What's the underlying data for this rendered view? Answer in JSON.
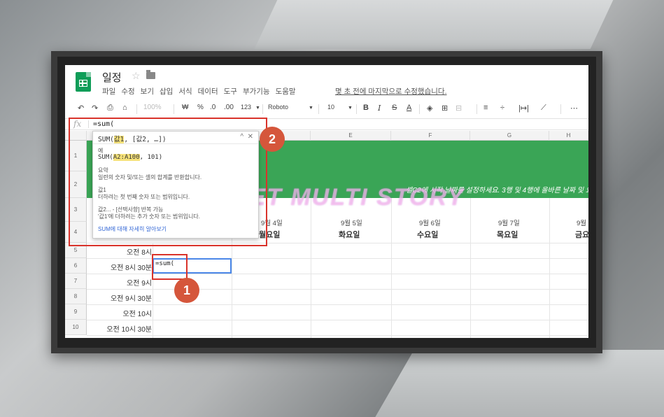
{
  "doc": {
    "title": "일정",
    "menu": [
      "파일",
      "수정",
      "보기",
      "삽입",
      "서식",
      "데이터",
      "도구",
      "부가기능",
      "도움말"
    ],
    "last_edit": "몇 초 전에 마지막으로 수정했습니다."
  },
  "toolbar": {
    "zoom": "100%",
    "currency": "₩",
    "percent": "%",
    "decimal_less": ".0",
    "decimal_more": ".00",
    "format": "123",
    "font": "Roboto",
    "font_size": "10",
    "bold": "B",
    "italic": "I",
    "strike": "S",
    "text_color": "A"
  },
  "formula_bar": {
    "fx": "fx",
    "value": "=sum("
  },
  "columns": [
    "E",
    "F",
    "G",
    "H"
  ],
  "rows": [
    "1",
    "2",
    "3",
    "4",
    "5",
    "6",
    "7",
    "8",
    "9",
    "10"
  ],
  "banner_text": "셀C2에 시작 날짜를 설정하세요. 3행 및 4행에 올바른 날짜 및 요",
  "watermark": "SWEET MULTI STORY",
  "dates": [
    "9월 4일",
    "9월 5일",
    "9월 6일",
    "9월 7일",
    "9월"
  ],
  "weekdays": [
    "월요일",
    "화요일",
    "수요일",
    "목요일",
    "금요"
  ],
  "times": [
    "오전 8시",
    "오전 8시 30분",
    "오전 9시",
    "오전 9시 30분",
    "오전 10시",
    "오전 10시 30분"
  ],
  "active_cell": "=sum(",
  "popup": {
    "signature_prefix": "SUM(",
    "signature_arg": "값1",
    "signature_suffix": ", [값2, …])",
    "example_label": "예",
    "example_prefix": "SUM(",
    "example_arg": "A2:A100",
    "example_suffix": ", 101)",
    "summary_label": "요약",
    "summary_text": "일련의 숫자 및/또는 셀의 합계를 반환합니다.",
    "arg1_label": "값1",
    "arg1_text": "더하려는 첫 번째 숫자 또는 범위입니다.",
    "arg2_label": "값2... - [선택사항] 반복 가능",
    "arg2_text": "'값1'에 더하려는 추가 숫자 또는 범위입니다.",
    "more_link": "SUM에 대해 자세히 알아보기"
  },
  "annotations": {
    "badge1": "1",
    "badge2": "2",
    "color": "#d9332b"
  }
}
